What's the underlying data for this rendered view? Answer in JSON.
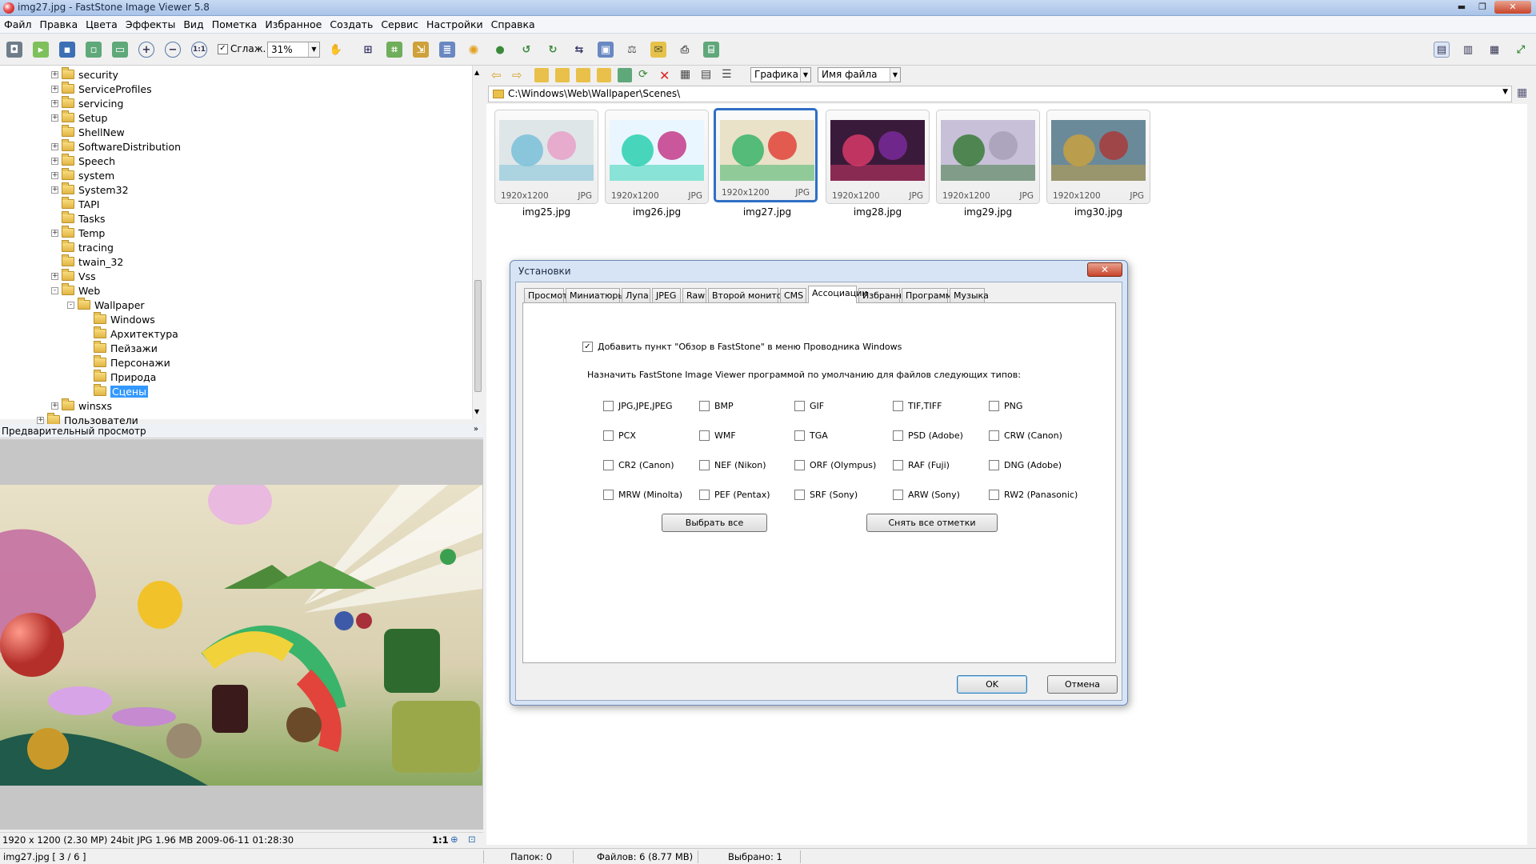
{
  "window": {
    "title": "img27.jpg  -  FastStone Image Viewer 5.8"
  },
  "menu": [
    "Файл",
    "Правка",
    "Цвета",
    "Эффекты",
    "Вид",
    "Пометка",
    "Избранное",
    "Создать",
    "Сервис",
    "Настройки",
    "Справка"
  ],
  "toolbar": {
    "smooth_label": "Сглаж.",
    "smooth_checked": true,
    "zoom_value": "31%"
  },
  "navbar": {
    "view_mode": "Графика",
    "sort_by": "Имя файла"
  },
  "path": "C:\\Windows\\Web\\Wallpaper\\Scenes\\",
  "tree": {
    "items": [
      {
        "label": "security",
        "level": 0,
        "expander": "+"
      },
      {
        "label": "ServiceProfiles",
        "level": 0,
        "expander": "+"
      },
      {
        "label": "servicing",
        "level": 0,
        "expander": "+"
      },
      {
        "label": "Setup",
        "level": 0,
        "expander": "+"
      },
      {
        "label": "ShellNew",
        "level": 0,
        "expander": ""
      },
      {
        "label": "SoftwareDistribution",
        "level": 0,
        "expander": "+"
      },
      {
        "label": "Speech",
        "level": 0,
        "expander": "+"
      },
      {
        "label": "system",
        "level": 0,
        "expander": "+"
      },
      {
        "label": "System32",
        "level": 0,
        "expander": "+"
      },
      {
        "label": "TAPI",
        "level": 0,
        "expander": ""
      },
      {
        "label": "Tasks",
        "level": 0,
        "expander": ""
      },
      {
        "label": "Temp",
        "level": 0,
        "expander": "+"
      },
      {
        "label": "tracing",
        "level": 0,
        "expander": ""
      },
      {
        "label": "twain_32",
        "level": 0,
        "expander": ""
      },
      {
        "label": "Vss",
        "level": 0,
        "expander": "+"
      },
      {
        "label": "Web",
        "level": 0,
        "expander": "-"
      },
      {
        "label": "Wallpaper",
        "level": 1,
        "expander": "-"
      },
      {
        "label": "Windows",
        "level": 2,
        "expander": ""
      },
      {
        "label": "Архитектура",
        "level": 2,
        "expander": ""
      },
      {
        "label": "Пейзажи",
        "level": 2,
        "expander": ""
      },
      {
        "label": "Персонажи",
        "level": 2,
        "expander": ""
      },
      {
        "label": "Природа",
        "level": 2,
        "expander": ""
      },
      {
        "label": "Сцены",
        "level": 2,
        "expander": "",
        "selected": true
      },
      {
        "label": "winsxs",
        "level": 0,
        "expander": "+"
      },
      {
        "label": "Пользователи",
        "level": -1,
        "expander": "+"
      }
    ]
  },
  "preview": {
    "header": "Предварительный просмотр",
    "info": "1920 x 1200 (2.30 MP)  24bit  JPG  1.96 MB  2009-06-11 01:28:30",
    "ratio": "1:1"
  },
  "thumbnails": [
    {
      "name": "img25.jpg",
      "dims": "1920x1200",
      "type": "JPG"
    },
    {
      "name": "img26.jpg",
      "dims": "1920x1200",
      "type": "JPG"
    },
    {
      "name": "img27.jpg",
      "dims": "1920x1200",
      "type": "JPG",
      "selected": true
    },
    {
      "name": "img28.jpg",
      "dims": "1920x1200",
      "type": "JPG"
    },
    {
      "name": "img29.jpg",
      "dims": "1920x1200",
      "type": "JPG"
    },
    {
      "name": "img30.jpg",
      "dims": "1920x1200",
      "type": "JPG"
    }
  ],
  "dialog": {
    "title": "Установки",
    "tabs": [
      "Просмотр",
      "Миниатюры",
      "Лупа",
      "JPEG",
      "Raw",
      "Второй монитор",
      "CMS",
      "Ассоциации",
      "Избранное",
      "Программы",
      "Музыка"
    ],
    "active_tab": "Ассоциации",
    "explorer_option": "Добавить пункт \"Обзор в FastStone\" в меню Проводника Windows",
    "explorer_checked": true,
    "assoc_label": "Назначить FastStone Image Viewer программой по умолчанию для файлов следующих типов:",
    "file_types": [
      [
        "JPG,JPE,JPEG",
        "BMP",
        "GIF",
        "TIF,TIFF",
        "PNG"
      ],
      [
        "PCX",
        "WMF",
        "TGA",
        "PSD (Adobe)",
        "CRW (Canon)"
      ],
      [
        "CR2 (Canon)",
        "NEF (Nikon)",
        "ORF (Olympus)",
        "RAF (Fuji)",
        "DNG (Adobe)"
      ],
      [
        "MRW (Minolta)",
        "PEF (Pentax)",
        "SRF (Sony)",
        "ARW (Sony)",
        "RW2 (Panasonic)"
      ]
    ],
    "select_all": "Выбрать все",
    "clear_all": "Снять все отметки",
    "ok": "OK",
    "cancel": "Отмена"
  },
  "status": {
    "file": "img27.jpg [ 3 / 6 ]",
    "folders": "Папок: 0",
    "files": "Файлов: 6 (8.77 MB)",
    "selected": "Выбрано: 1"
  }
}
